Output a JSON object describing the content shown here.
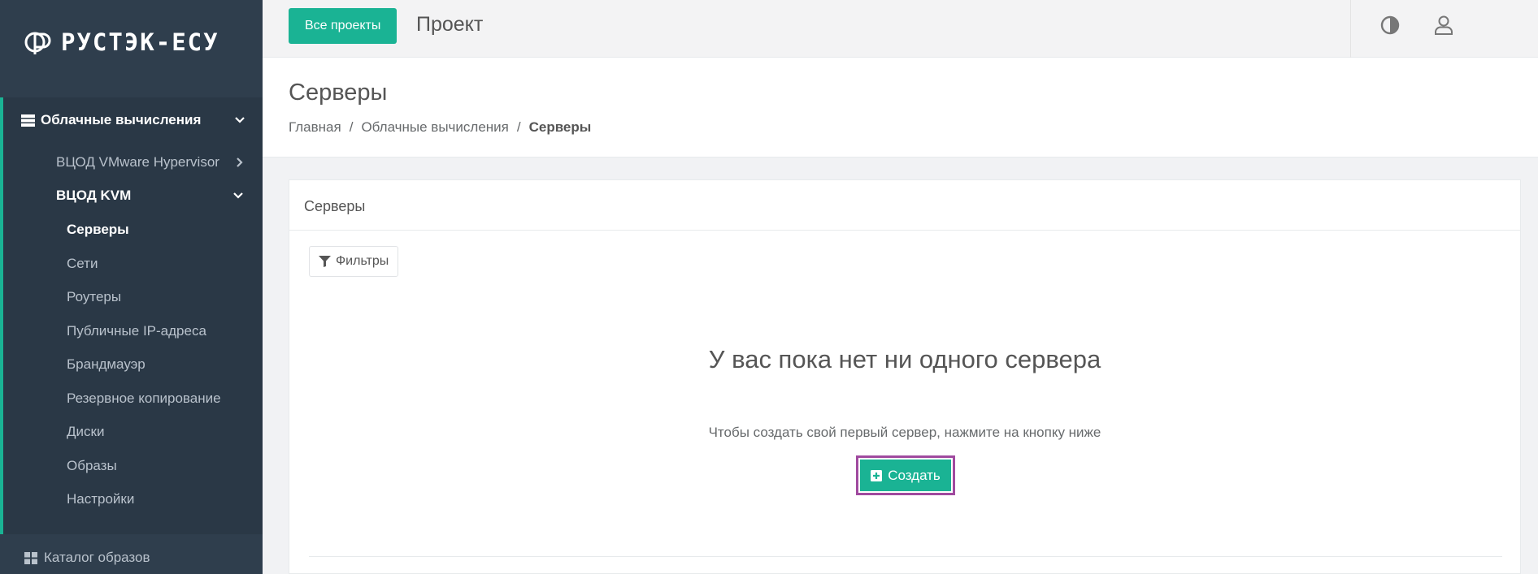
{
  "brand": {
    "logo_text": "РУСТЭК-ЕСУ"
  },
  "topbar": {
    "all_projects_label": "Все проекты",
    "project_title": "Проект",
    "theme_icon": "contrast-icon",
    "user_icon": "user-icon"
  },
  "sidebar": {
    "group": {
      "label": "Облачные вычисления",
      "icon": "server-stack-icon"
    },
    "subgroups": [
      {
        "label": "ВЦОД VMware Hypervisor",
        "icon": "chevron-right-icon"
      },
      {
        "label": "ВЦОД KVM",
        "icon": "chevron-down-icon"
      }
    ],
    "items": [
      {
        "label": "Серверы",
        "active": true
      },
      {
        "label": "Сети"
      },
      {
        "label": "Роутеры"
      },
      {
        "label": "Публичные IP-адреса"
      },
      {
        "label": "Брандмауэр"
      },
      {
        "label": "Резервное копирование"
      },
      {
        "label": "Диски"
      },
      {
        "label": "Образы"
      },
      {
        "label": "Настройки"
      }
    ],
    "catalog": {
      "label": "Каталог образов",
      "icon": "grid-icon"
    }
  },
  "page": {
    "title": "Серверы",
    "breadcrumb": [
      "Главная",
      "/",
      "Облачные вычисления",
      "/",
      "Серверы"
    ]
  },
  "panel": {
    "title": "Серверы",
    "filter_label": "Фильтры",
    "empty_title": "У вас пока нет ни одного сервера",
    "empty_subtitle": "Чтобы создать свой первый сервер, нажмите на кнопку ниже",
    "create_label": "Создать"
  },
  "colors": {
    "accent": "#1ab394",
    "sidebar_bg": "#2f3e4d",
    "highlight_border": "#a04a9f"
  }
}
